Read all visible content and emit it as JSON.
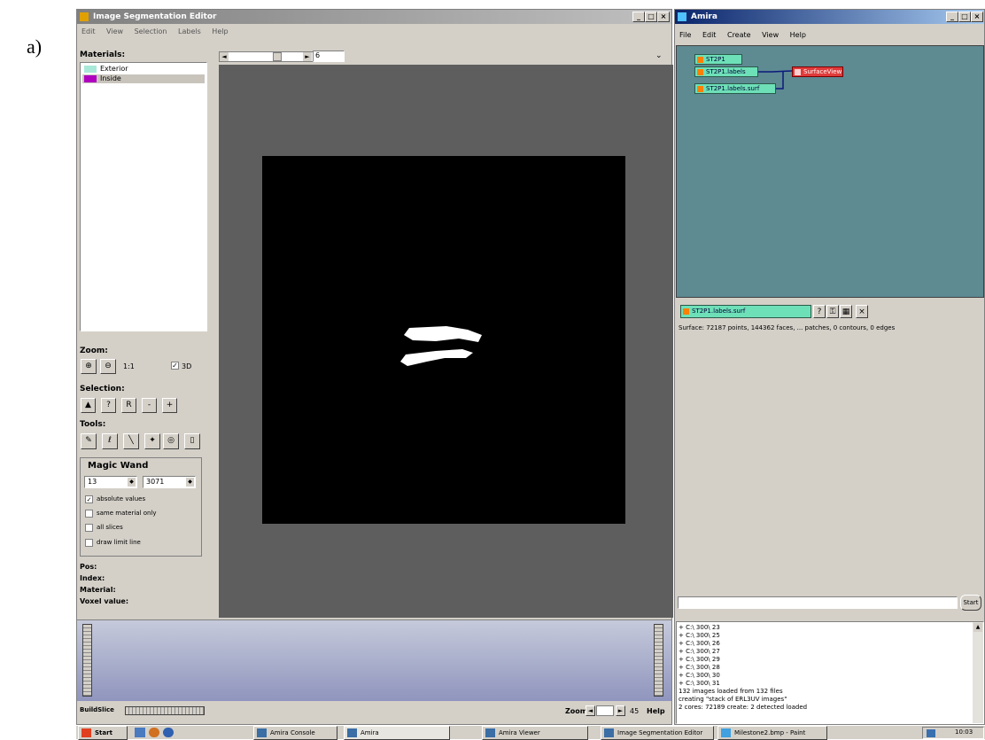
{
  "figure_label": "a)",
  "segmentation_editor": {
    "title": "Image Segmentation Editor",
    "menu": [
      "Edit",
      "View",
      "Selection",
      "Labels",
      "Help"
    ],
    "materials_label": "Materials:",
    "materials": [
      {
        "name": "Exterior",
        "color": "#a8e8d8"
      },
      {
        "name": "Inside",
        "color": "#b000c0"
      }
    ],
    "slice_value": "6",
    "zoom_label": "Zoom:",
    "zoom_ratio": "1:1",
    "zoom_3d": "3D",
    "selection_label": "Selection:",
    "selection_buttons": [
      "▲",
      "?",
      "R",
      "-",
      "+"
    ],
    "tools_label": "Tools:",
    "magic_wand": {
      "title": "Magic Wand",
      "low": "13",
      "high": "3071",
      "options": [
        {
          "label": "absolute values",
          "checked": true
        },
        {
          "label": "same material only",
          "checked": false
        },
        {
          "label": "all slices",
          "checked": false
        },
        {
          "label": "draw limit line",
          "checked": false
        }
      ]
    },
    "info": [
      "Pos:",
      "Index:",
      "Material:",
      "Voxel value:"
    ],
    "bottom": {
      "slice_label": "BuildSlice",
      "zoom_label": "Zoom",
      "zoom_value": "45",
      "help_label": "Help"
    }
  },
  "amira": {
    "title": "Amira",
    "menu": [
      "File",
      "Edit",
      "Create",
      "View",
      "Help"
    ],
    "nodes": [
      "ST2P1",
      "ST2P1.labels",
      "ST2P1.labels.surf",
      "SurfaceView"
    ],
    "selected_module": "ST2P1.labels.surf",
    "surface_info": "Surface: 72187 points, 144362 faces,  ... patches, 0 contours, 0 edges",
    "start_button": "Start",
    "console_lines": [
      "+ C:\\ 300\\ 23",
      "+ C:\\ 300\\ 25",
      "+ C:\\ 300\\ 26",
      "+ C:\\ 300\\ 27",
      "+ C:\\ 300\\ 29",
      "+ C:\\ 300\\ 28",
      "+ C:\\ 300\\ 30",
      "+ C:\\ 300\\ 31",
      "132 images loaded from 132 files",
      "creating \"stack of ERL3UV images\"",
      "2 cores: 72189 create: 2 detected loaded"
    ]
  },
  "taskbar": {
    "start": "Start",
    "tasks": [
      "Amira Console",
      "Amira",
      "Amira Viewer",
      "Image Segmentation Editor",
      "Milestone2.bmp - Paint"
    ],
    "clock": "10:03"
  }
}
